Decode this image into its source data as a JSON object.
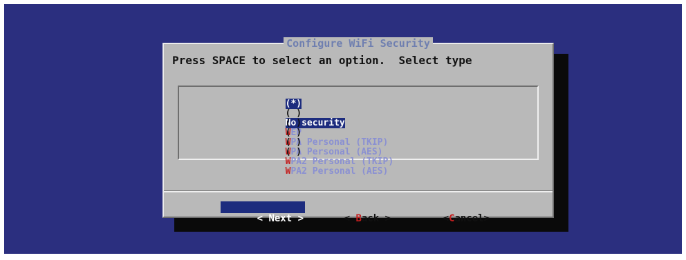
{
  "dialog": {
    "title": "Configure WiFi Security",
    "prompt": "Press SPACE to select an option.  Select type"
  },
  "options": [
    {
      "mark": "(*)",
      "hotkey": "N",
      "rest": "o security",
      "selected": true
    },
    {
      "mark": "( )",
      "hotkey": "W",
      "rest": "EP",
      "selected": false
    },
    {
      "mark": "( )",
      "hotkey": "W",
      "rest": "PA Personal (TKIP)",
      "selected": false
    },
    {
      "mark": "( )",
      "hotkey": "W",
      "rest": "PA Personal (AES)",
      "selected": false
    },
    {
      "mark": "( )",
      "hotkey": "W",
      "rest": "PA2 Personal (TKIP)",
      "selected": false
    },
    {
      "mark": "( )",
      "hotkey": "W",
      "rest": "PA2 Personal (AES)",
      "selected": false
    }
  ],
  "buttons": {
    "next": {
      "open": "< ",
      "hotkey": "N",
      "rest": "ext >"
    },
    "back": {
      "open": "< ",
      "hotkey": "B",
      "rest": "ack >"
    },
    "cancel": {
      "open": "<",
      "hotkey": "C",
      "rest": "ancel>"
    }
  },
  "colors": {
    "screen_bg": "#2b2f7f",
    "dialog_bg": "#b9b9b9",
    "selection_bg": "#1d2c7e",
    "hotkey": "#c31f1f",
    "option_text": "#8a90d2"
  }
}
